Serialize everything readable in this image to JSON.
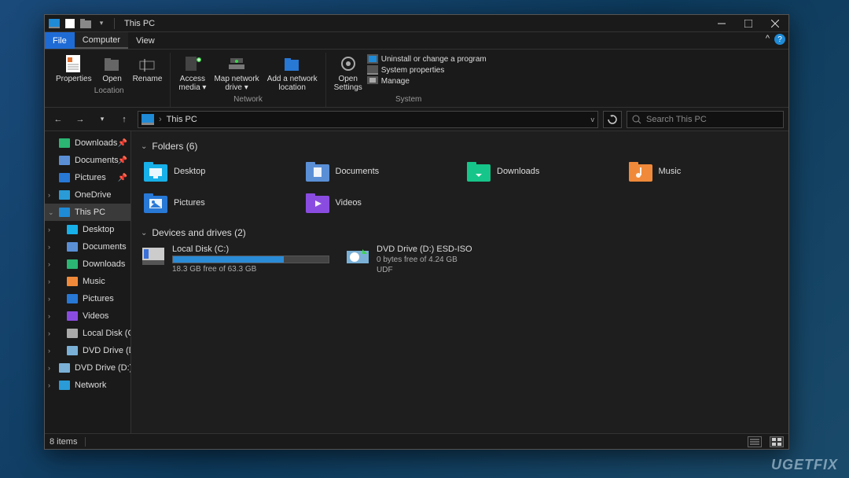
{
  "titlebar": {
    "title": "This PC"
  },
  "tabs": {
    "file": "File",
    "computer": "Computer",
    "view": "View"
  },
  "ribbon": {
    "location": {
      "label": "Location",
      "properties": "Properties",
      "open": "Open",
      "rename": "Rename"
    },
    "network": {
      "label": "Network",
      "access_media": "Access\nmedia ▾",
      "map_drive": "Map network\ndrive ▾",
      "add_location": "Add a network\nlocation"
    },
    "system": {
      "label": "System",
      "open_settings": "Open\nSettings",
      "uninstall": "Uninstall or change a program",
      "sys_props": "System properties",
      "manage": "Manage"
    }
  },
  "address": {
    "crumb": "This PC"
  },
  "search": {
    "placeholder": "Search This PC"
  },
  "sidebar": {
    "items": [
      {
        "label": "Downloads",
        "pinned": true,
        "icon": "download"
      },
      {
        "label": "Documents",
        "pinned": true,
        "icon": "document"
      },
      {
        "label": "Pictures",
        "pinned": true,
        "icon": "pictures"
      },
      {
        "label": "OneDrive",
        "chev": ">",
        "icon": "cloud"
      },
      {
        "label": "This PC",
        "chev": "v",
        "icon": "pc",
        "selected": true
      },
      {
        "label": "Desktop",
        "chev": ">",
        "icon": "desktop",
        "indent": true
      },
      {
        "label": "Documents",
        "chev": ">",
        "icon": "document",
        "indent": true
      },
      {
        "label": "Downloads",
        "chev": ">",
        "icon": "download",
        "indent": true
      },
      {
        "label": "Music",
        "chev": ">",
        "icon": "music",
        "indent": true
      },
      {
        "label": "Pictures",
        "chev": ">",
        "icon": "pictures",
        "indent": true
      },
      {
        "label": "Videos",
        "chev": ">",
        "icon": "videos",
        "indent": true
      },
      {
        "label": "Local Disk (C:)",
        "chev": ">",
        "icon": "disk",
        "indent": true
      },
      {
        "label": "DVD Drive (D:) E",
        "chev": ">",
        "icon": "dvd",
        "indent": true
      },
      {
        "label": "DVD Drive (D:) E",
        "chev": ">",
        "icon": "dvd"
      },
      {
        "label": "Network",
        "chev": ">",
        "icon": "network"
      }
    ]
  },
  "content": {
    "folders_header": "Folders (6)",
    "folders": [
      {
        "name": "Desktop",
        "color": "#17b0e8",
        "glyph": "desktop"
      },
      {
        "name": "Documents",
        "color": "#5a8fd6",
        "glyph": "doc"
      },
      {
        "name": "Downloads",
        "color": "#16c589",
        "glyph": "down"
      },
      {
        "name": "Music",
        "color": "#f08a3a",
        "glyph": "music"
      },
      {
        "name": "Pictures",
        "color": "#2878d6",
        "glyph": "pic"
      },
      {
        "name": "Videos",
        "color": "#8a4ce0",
        "glyph": "play"
      }
    ],
    "drives_header": "Devices and drives (2)",
    "drives": [
      {
        "name": "Local Disk (C:)",
        "sub": "18.3 GB free of 63.3 GB",
        "fill_pct": 71,
        "icon": "hdd"
      },
      {
        "name": "DVD Drive (D:) ESD-ISO",
        "sub": "0 bytes free of 4.24 GB",
        "sub2": "UDF",
        "icon": "dvd"
      }
    ]
  },
  "status": {
    "text": "8 items"
  },
  "watermark": "UGETFIX"
}
